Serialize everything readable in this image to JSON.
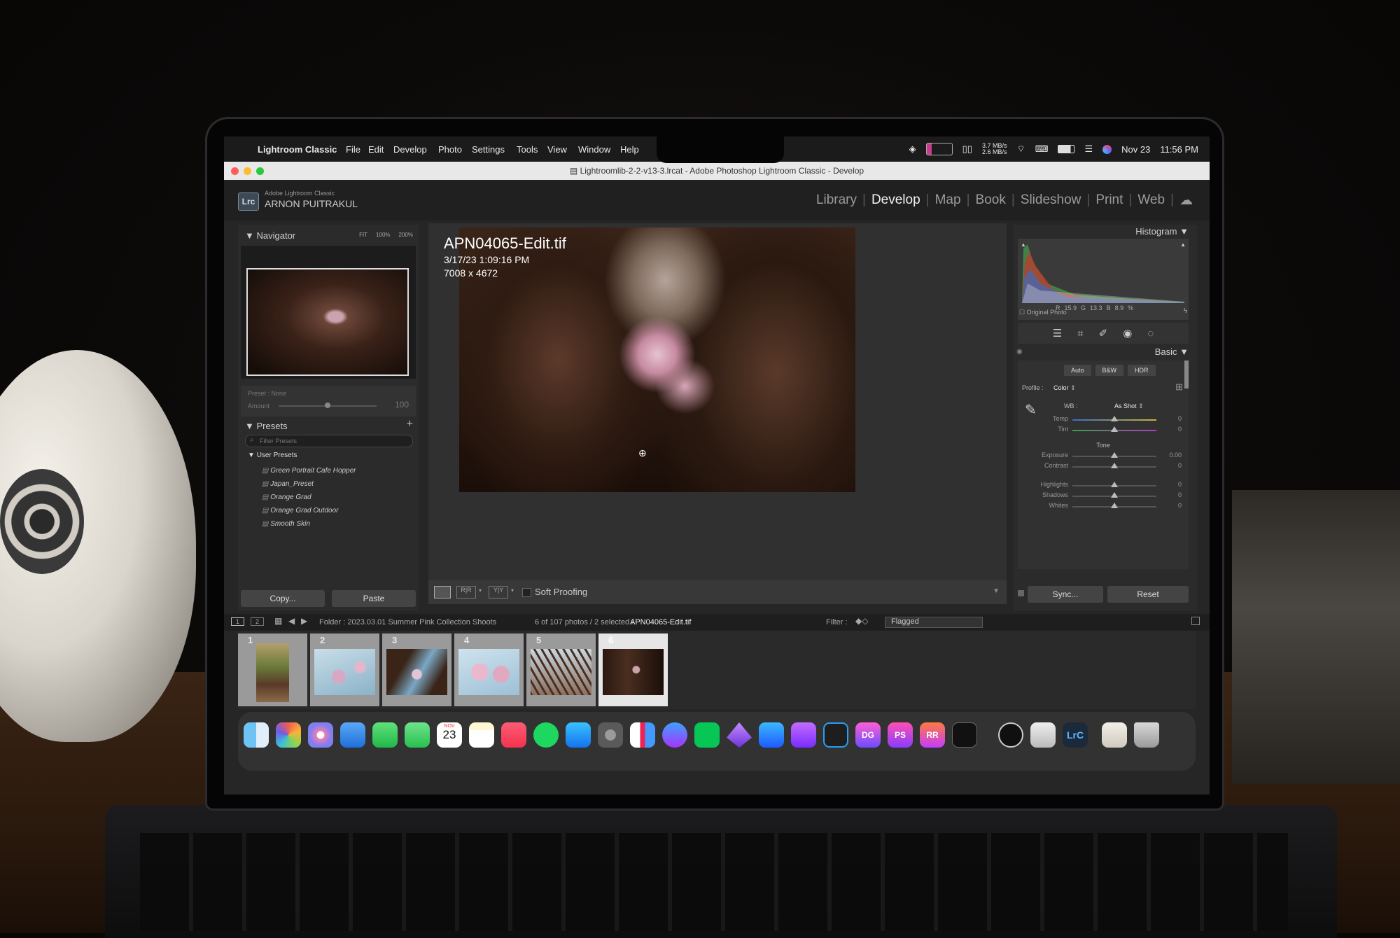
{
  "menubar": {
    "app_name": "Lightroom Classic",
    "items": [
      "File",
      "Edit",
      "Develop",
      "Photo",
      "Settings",
      "Tools",
      "View",
      "Window",
      "Help"
    ],
    "net_up": "3.7 MB/s",
    "net_down": "2.6 MB/s",
    "date": "Nov 23",
    "time": "11:56 PM"
  },
  "window": {
    "title": "Lightroomlib-2-2-v13-3.lrcat - Adobe Photoshop Lightroom Classic - Develop"
  },
  "identity": {
    "product": "Adobe Lightroom Classic",
    "user": "ARNON PUITRAKUL",
    "badge": "Lrc"
  },
  "modules": {
    "items": [
      "Library",
      "Develop",
      "Map",
      "Book",
      "Slideshow",
      "Print",
      "Web"
    ],
    "active": "Develop"
  },
  "navigator": {
    "title": "Navigator",
    "zoom_options": [
      "FIT",
      "100%",
      "200%"
    ]
  },
  "preset_amount": {
    "preset_label": "Preset",
    "preset_value": "None",
    "amount_label": "Amount",
    "amount_value": "100"
  },
  "presets": {
    "title": "Presets",
    "filter_placeholder": "Filter Presets",
    "group": "User Presets",
    "items": [
      "Green Portrait Cafe Hopper",
      "Japan_Preset",
      "Orange Grad",
      "Orange Grad Outdoor",
      "Smooth Skin"
    ]
  },
  "left_buttons": {
    "copy": "Copy...",
    "paste": "Paste"
  },
  "photo": {
    "filename": "APN04065-Edit.tif",
    "datetime": "3/17/23 1:09:16 PM",
    "dimensions": "7008 x 4672"
  },
  "toolbar": {
    "soft_proofing": "Soft Proofing"
  },
  "histogram": {
    "title": "Histogram",
    "r_label": "R",
    "r_value": "15.9",
    "g_label": "G",
    "g_value": "13.3",
    "b_label": "B",
    "b_value": "8.9",
    "percent": "%",
    "original_photo": "Original Photo"
  },
  "basic": {
    "title": "Basic",
    "treatments": [
      "Auto",
      "B&W",
      "HDR"
    ],
    "profile_label": "Profile :",
    "profile_value": "Color",
    "wb_label": "WB :",
    "wb_value": "As Shot",
    "tone_label": "Tone",
    "sliders": [
      {
        "label": "Temp",
        "value": "0",
        "position": 0.5
      },
      {
        "label": "Tint",
        "value": "0",
        "position": 0.5
      },
      {
        "label": "Exposure",
        "value": "0.00",
        "position": 0.5
      },
      {
        "label": "Contrast",
        "value": "0",
        "position": 0.5
      },
      {
        "label": "Highlights",
        "value": "0",
        "position": 0.5
      },
      {
        "label": "Shadows",
        "value": "0",
        "position": 0.5
      },
      {
        "label": "Whites",
        "value": "0",
        "position": 0.5
      }
    ]
  },
  "right_buttons": {
    "sync": "Sync...",
    "reset": "Reset"
  },
  "filmstrip_header": {
    "views": [
      "1",
      "2"
    ],
    "folder": "Folder : 2023.03.01 Summer Pink Collection Shoots",
    "count": "6 of 107 photos / 2 selected /",
    "selected_file": "APN04065-Edit.tif",
    "filter_label": "Filter :",
    "filter_value": "Flagged"
  },
  "filmstrip": {
    "numbers": [
      "1",
      "2",
      "3",
      "4",
      "5",
      "6"
    ]
  },
  "dock": {
    "calendar_month": "NOV",
    "calendar_day": "23",
    "lrc_label": "LrC",
    "ps_label": "PS",
    "rr_label": "RR",
    "dg_label": "DG"
  }
}
